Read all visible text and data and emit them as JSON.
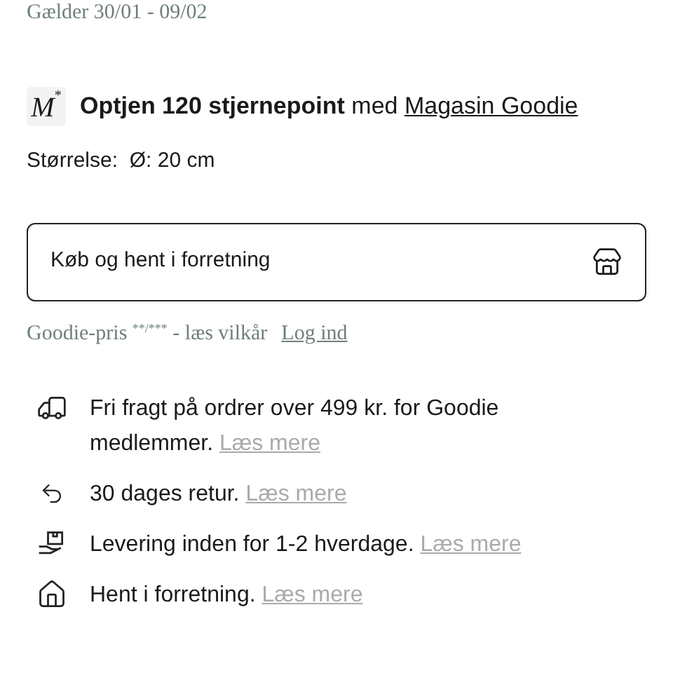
{
  "validity": "Gælder 30/01 - 09/02",
  "points": {
    "badge": "M",
    "badge_mark": "*",
    "text": "**Optjen 120 stjernepoint** med",
    "link": "Magasin Goodie"
  },
  "size": {
    "label": "Størrelse:",
    "value": "Ø: 20 cm"
  },
  "store_button": {
    "label": "Køb og hent i forretning"
  },
  "goodie": {
    "text": "Goodie-pris",
    "marks": "**/***",
    "rest": "- læs vilkår",
    "link": "Log ind"
  },
  "benefits": [
    {
      "kind": "truck",
      "text": "Fri fragt på ordrer over 499 kr. for Goodie medlemmer.",
      "link": "Læs mere"
    },
    {
      "kind": "return",
      "text": "30 dages retur.",
      "link": "Læs mere"
    },
    {
      "kind": "delivery",
      "text": "Levering inden for 1-2 hverdage.",
      "link": "Læs mere"
    },
    {
      "kind": "home",
      "text": "Hent i forretning.",
      "link": "Læs mere"
    }
  ]
}
